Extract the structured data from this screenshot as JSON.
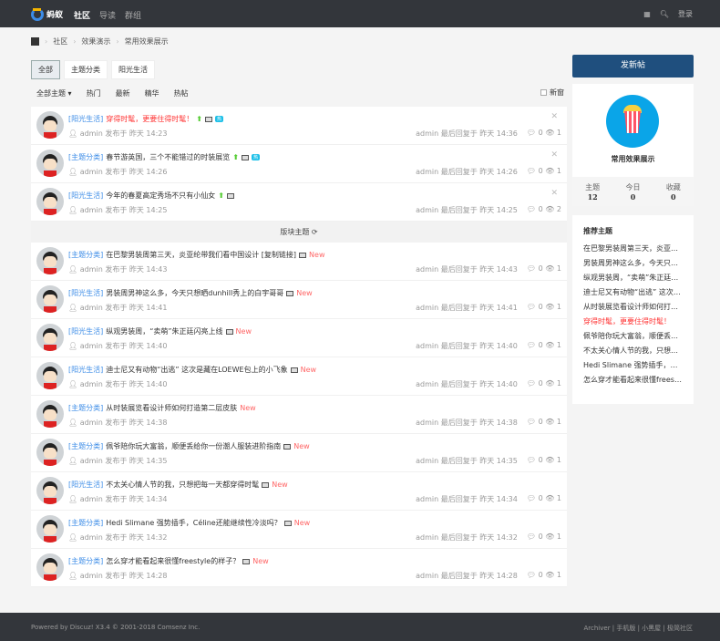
{
  "header": {
    "logo": "蚂蚁",
    "nav": [
      "社区",
      "导读",
      "群组"
    ],
    "login": "登录"
  },
  "breadcrumb": [
    "社区",
    "效果演示",
    "常用效果展示"
  ],
  "tabs": [
    "全部",
    "主题分类",
    "阳光生活"
  ],
  "filters": [
    "全部主题 ▾",
    "热门",
    "最新",
    "精华",
    "热帖"
  ],
  "new_window": "新窗",
  "section_bar": "版块主题 ⟳",
  "sticky": [
    {
      "cat": "[阳光生活]",
      "title": "穿得时髦，更要住得时髦！",
      "red": true,
      "hot": "热",
      "author": "admin",
      "posted": "发布于 昨天 14:23",
      "last": "admin 最后回复于 昨天 14:36",
      "replies": "0",
      "views": "1"
    },
    {
      "cat": "[主题分类]",
      "title": "春节游英国，三个不能错过的时装展览",
      "red": false,
      "hot": "热",
      "author": "admin",
      "posted": "发布于 昨天 14:26",
      "last": "admin 最后回复于 昨天 14:26",
      "replies": "0",
      "views": "1"
    },
    {
      "cat": "[阳光生活]",
      "title": "今年的春夏高定秀场不只有小仙女",
      "red": false,
      "hot": "",
      "author": "admin",
      "posted": "发布于 昨天 14:25",
      "last": "admin 最后回复于 昨天 14:25",
      "replies": "0",
      "views": "2"
    }
  ],
  "threads": [
    {
      "cat": "[主题分类]",
      "title": "在巴黎男装周第三天，炎亚纶带我们看中国设计 [复制链接]",
      "img": true,
      "author": "admin",
      "posted": "发布于 昨天 14:43",
      "last": "admin 最后回复于 昨天 14:43",
      "replies": "0",
      "views": "1"
    },
    {
      "cat": "[阳光生活]",
      "title": "男装周男神这么多，今天只想晒dunhill秀上的白宇哥哥",
      "img": true,
      "author": "admin",
      "posted": "发布于 昨天 14:41",
      "last": "admin 最后回复于 昨天 14:41",
      "replies": "0",
      "views": "1"
    },
    {
      "cat": "[阳光生活]",
      "title": "纵观男装周，“卖萌”朱正廷闪亮上线",
      "img": true,
      "author": "admin",
      "posted": "发布于 昨天 14:40",
      "last": "admin 最后回复于 昨天 14:40",
      "replies": "0",
      "views": "1"
    },
    {
      "cat": "[阳光生活]",
      "title": "迪士尼又有动物“出逃” 这次是藏在LOEWE包上的小飞象",
      "img": true,
      "author": "admin",
      "posted": "发布于 昨天 14:40",
      "last": "admin 最后回复于 昨天 14:40",
      "replies": "0",
      "views": "1"
    },
    {
      "cat": "[主题分类]",
      "title": "从时装展览看设计师如何打造第二层皮肤",
      "img": false,
      "author": "admin",
      "posted": "发布于 昨天 14:38",
      "last": "admin 最后回复于 昨天 14:38",
      "replies": "0",
      "views": "1"
    },
    {
      "cat": "[主题分类]",
      "title": "佩爷陪你玩大富翁，顺便丢给你一份潮人服装进阶指南",
      "img": true,
      "author": "admin",
      "posted": "发布于 昨天 14:35",
      "last": "admin 最后回复于 昨天 14:35",
      "replies": "0",
      "views": "1"
    },
    {
      "cat": "[阳光生活]",
      "title": "不太关心情人节的我，只想把每一天都穿得时髦",
      "img": true,
      "author": "admin",
      "posted": "发布于 昨天 14:34",
      "last": "admin 最后回复于 昨天 14:34",
      "replies": "0",
      "views": "1"
    },
    {
      "cat": "[主题分类]",
      "title": "Hedi Slimane 强势插手，Céline还能继续性冷淡吗？",
      "img": true,
      "author": "admin",
      "posted": "发布于 昨天 14:32",
      "last": "admin 最后回复于 昨天 14:32",
      "replies": "0",
      "views": "1"
    },
    {
      "cat": "[主题分类]",
      "title": "怎么穿才能看起来很懂freestyle的样子？",
      "img": true,
      "author": "admin",
      "posted": "发布于 昨天 14:28",
      "last": "admin 最后回复于 昨天 14:28",
      "replies": "0",
      "views": "1"
    }
  ],
  "new_label": "New",
  "sidebar": {
    "post_button": "发新帖",
    "forum_name": "常用效果展示",
    "stats": [
      {
        "label": "主题",
        "value": "12"
      },
      {
        "label": "今日",
        "value": "0"
      },
      {
        "label": "收藏",
        "value": "0"
      }
    ],
    "rec_title": "推荐主题",
    "rec": [
      "在巴黎男装周第三天，炎亚纶带我们看中国设计",
      "男装周男神这么多，今天只想晒dunhill秀上的白宇哥哥",
      "纵观男装周，“卖萌”朱正廷闪亮上线",
      "迪士尼又有动物“出逃” 这次是藏在LOEWE包上的小飞象",
      "从时装展览看设计师如何打造第二层皮肤",
      "穿得时髦，更要住得时髦！",
      "佩爷陪你玩大富翁，顺便丢给你一份潮人服装进阶指南",
      "不太关心情人节的我，只想把每一天都穿得时髦",
      "Hedi Slimane 强势插手，Céline还能继续性冷淡吗？",
      "怎么穿才能看起来很懂freestyle的样子？"
    ],
    "rec_red_index": 5
  },
  "footer": {
    "left": "Powered by Discuz! X3.4 © 2001-2018 Comsenz Inc.",
    "right": "Archiver | 手机版 | 小黑屋 | 极简社区"
  },
  "colors": {
    "topbar": "#33363b",
    "accent": "#1f4f7e",
    "category": "#3c8ce7",
    "highlight": "#ff3333"
  }
}
